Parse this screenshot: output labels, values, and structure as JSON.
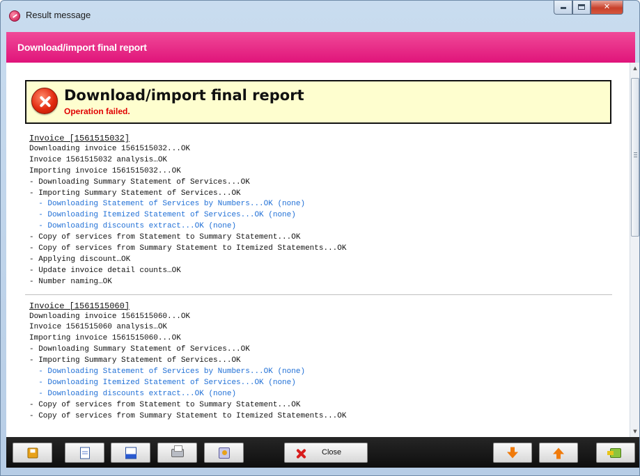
{
  "window": {
    "title": "Result message",
    "buttons": {
      "minimize": "minimize",
      "maximize": "maximize",
      "close": "close"
    }
  },
  "header": {
    "title": "Download/import final report"
  },
  "alert": {
    "title": "Download/import final report",
    "subtitle": "Operation failed.",
    "icon": "error-icon",
    "colors": {
      "background": "#fefecf",
      "subtitle": "#e00000"
    }
  },
  "log": {
    "sections": [
      {
        "heading": "Invoice [1561515032]",
        "lines": [
          {
            "text": "Downloading invoice 1561515032...OK",
            "level": 0
          },
          {
            "text": "Invoice 1561515032 analysis…OK",
            "level": 0
          },
          {
            "text": "Importing invoice 1561515032...OK",
            "level": 0
          },
          {
            "text": "- Downloading Summary Statement of Services...OK",
            "level": 0
          },
          {
            "text": "- Importing Summary Statement of Services...OK",
            "level": 0
          },
          {
            "text": "  - Downloading Statement of Services by Numbers...OK (none)",
            "level": 1
          },
          {
            "text": "  - Downloading Itemized Statement of Services...OK (none)",
            "level": 1
          },
          {
            "text": "  - Downloading discounts extract...OK (none)",
            "level": 1
          },
          {
            "text": "- Copy of services from Statement to Summary Statement...OK",
            "level": 0
          },
          {
            "text": "- Copy of services from Summary Statement to Itemized Statements...OK",
            "level": 0
          },
          {
            "text": "- Applying discount…OK",
            "level": 0
          },
          {
            "text": "- Update invoice detail counts…OK",
            "level": 0
          },
          {
            "text": "- Number naming…OK",
            "level": 0
          }
        ]
      },
      {
        "heading": "Invoice [1561515060]",
        "lines": [
          {
            "text": "Downloading invoice 1561515060...OK",
            "level": 0
          },
          {
            "text": "Invoice 1561515060 analysis…OK",
            "level": 0
          },
          {
            "text": "Importing invoice 1561515060...OK",
            "level": 0
          },
          {
            "text": "- Downloading Summary Statement of Services...OK",
            "level": 0
          },
          {
            "text": "- Importing Summary Statement of Services...OK",
            "level": 0
          },
          {
            "text": "  - Downloading Statement of Services by Numbers...OK (none)",
            "level": 1
          },
          {
            "text": "  - Downloading Itemized Statement of Services...OK (none)",
            "level": 1
          },
          {
            "text": "  - Downloading discounts extract...OK (none)",
            "level": 1
          },
          {
            "text": "- Copy of services from Statement to Summary Statement...OK",
            "level": 0
          },
          {
            "text": "- Copy of services from Summary Statement to Itemized Statements...OK",
            "level": 0
          }
        ]
      }
    ],
    "colors": {
      "nested": "#1f6fd6"
    }
  },
  "toolbar": {
    "close_label": "Close",
    "buttons": [
      {
        "name": "save-button",
        "icon": "save-icon"
      },
      {
        "name": "copy-button",
        "icon": "document-icon"
      },
      {
        "name": "export-html-button",
        "icon": "html-icon"
      },
      {
        "name": "print-button",
        "icon": "printer-icon"
      },
      {
        "name": "settings-button",
        "icon": "tools-icon"
      },
      {
        "name": "close-button",
        "icon": "close-icon"
      },
      {
        "name": "next-error-button",
        "icon": "arrow-down-icon"
      },
      {
        "name": "previous-error-button",
        "icon": "arrow-up-icon"
      },
      {
        "name": "exit-button",
        "icon": "exit-icon"
      }
    ]
  },
  "theme": {
    "accent": "#e0147a",
    "toolbar": "#1a1a1a"
  }
}
